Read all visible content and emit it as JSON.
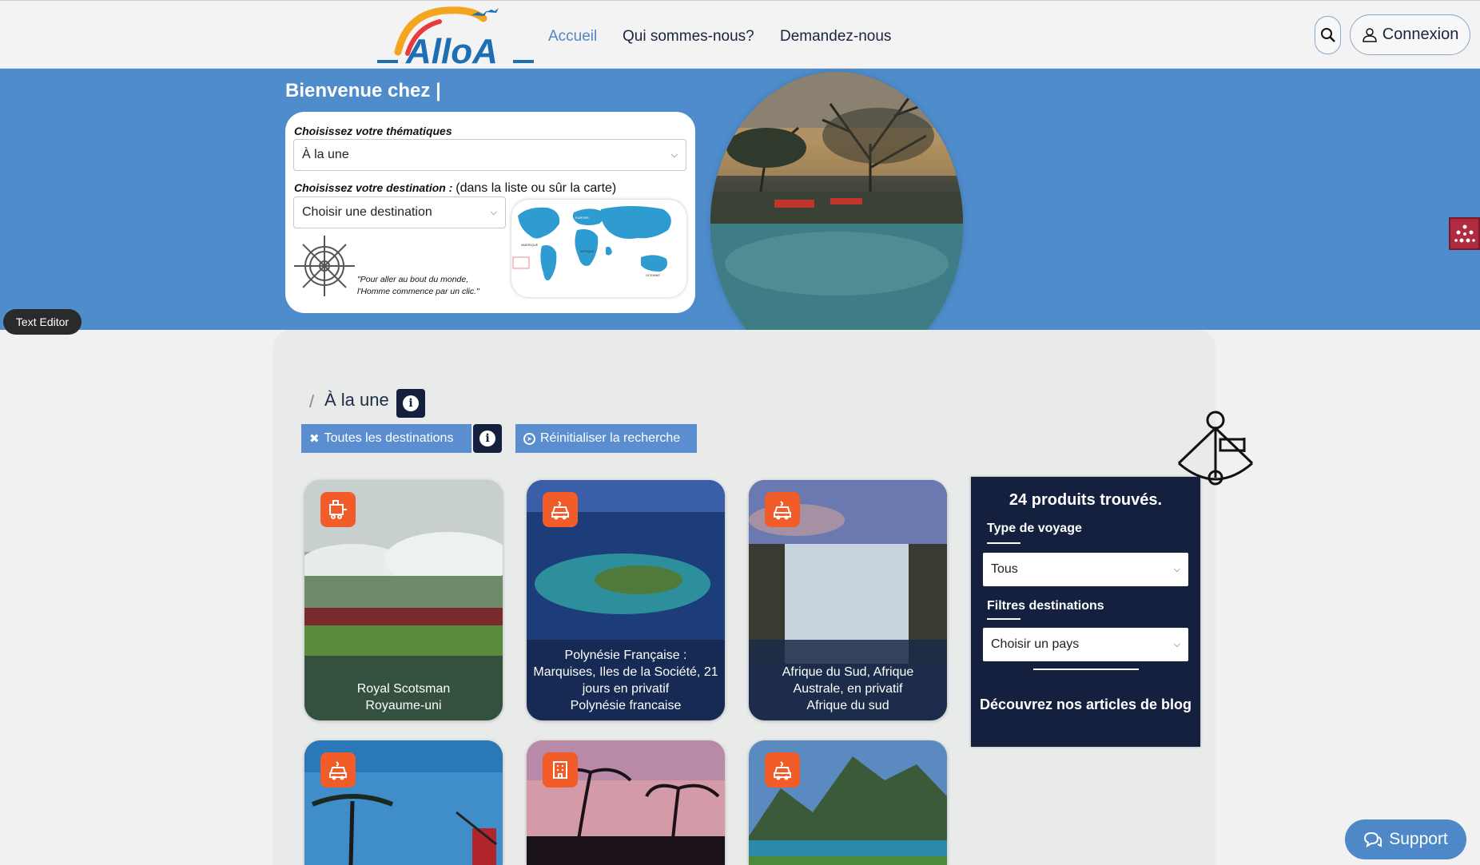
{
  "header": {
    "logo_text": "AlloA",
    "nav": [
      {
        "label": "Accueil",
        "active": true
      },
      {
        "label": "Qui sommes-nous?",
        "active": false
      },
      {
        "label": "Demandez-nous",
        "active": false
      }
    ],
    "search_icon": "search-icon",
    "login_label": "Connexion",
    "login_icon": "user-icon"
  },
  "hero": {
    "welcome": "Bienvenue chez |",
    "thematique_label": "Choisissez votre thématiques",
    "thematique_value": "À la une",
    "destination_label": "Choisissez votre destination :",
    "destination_hint": "(dans la liste ou sûr la carte)",
    "destination_value": "Choisir une destination",
    "quote_line1": "\"Pour aller au bout du monde,",
    "quote_line2": "l'Homme commence par un clic.\"",
    "map_labels": {
      "europe": "EUROPE",
      "amerique": "AMERIQUE",
      "afrique": "AFRIQUE",
      "oceanie": "OCEANIE"
    }
  },
  "text_editor_label": "Text Editor",
  "breadcrumb": {
    "separator": "/",
    "current": "À la une",
    "info": "i"
  },
  "buttons": {
    "all_destinations": "Toutes les destinations",
    "info": "i",
    "reset": "Réinitialiser la recherche"
  },
  "cards": [
    {
      "line1": "Royal Scotsman",
      "line2": "Royaume-uni",
      "line3": "",
      "line4": "",
      "badge_icon": "train-icon"
    },
    {
      "line1": "Polynésie Française :",
      "line2": "Marquises, Iles de la Société, 21",
      "line3": "jours en privatif",
      "line4": "Polynésie francaise",
      "badge_icon": "car-icon"
    },
    {
      "line1": "Afrique du Sud, Afrique",
      "line2": "Australe, en privatif",
      "line3": "Afrique du sud",
      "line4": "",
      "badge_icon": "car-icon"
    },
    {
      "badge_icon": "car-icon"
    },
    {
      "badge_icon": "hotel-icon"
    },
    {
      "badge_icon": "car-icon"
    }
  ],
  "filter": {
    "count": "24 produits trouvés.",
    "type_label": "Type de voyage",
    "type_value": "Tous",
    "dest_label": "Filtres destinations",
    "dest_value": "Choisir un pays",
    "blog": "Découvrez nos articles de blog"
  },
  "support_label": "Support",
  "colors": {
    "hero_blue": "#4f8ccb",
    "navy": "#14203e",
    "orange": "#f25c28",
    "button_blue": "#5b8ed0",
    "active_nav": "#4f86c0"
  }
}
